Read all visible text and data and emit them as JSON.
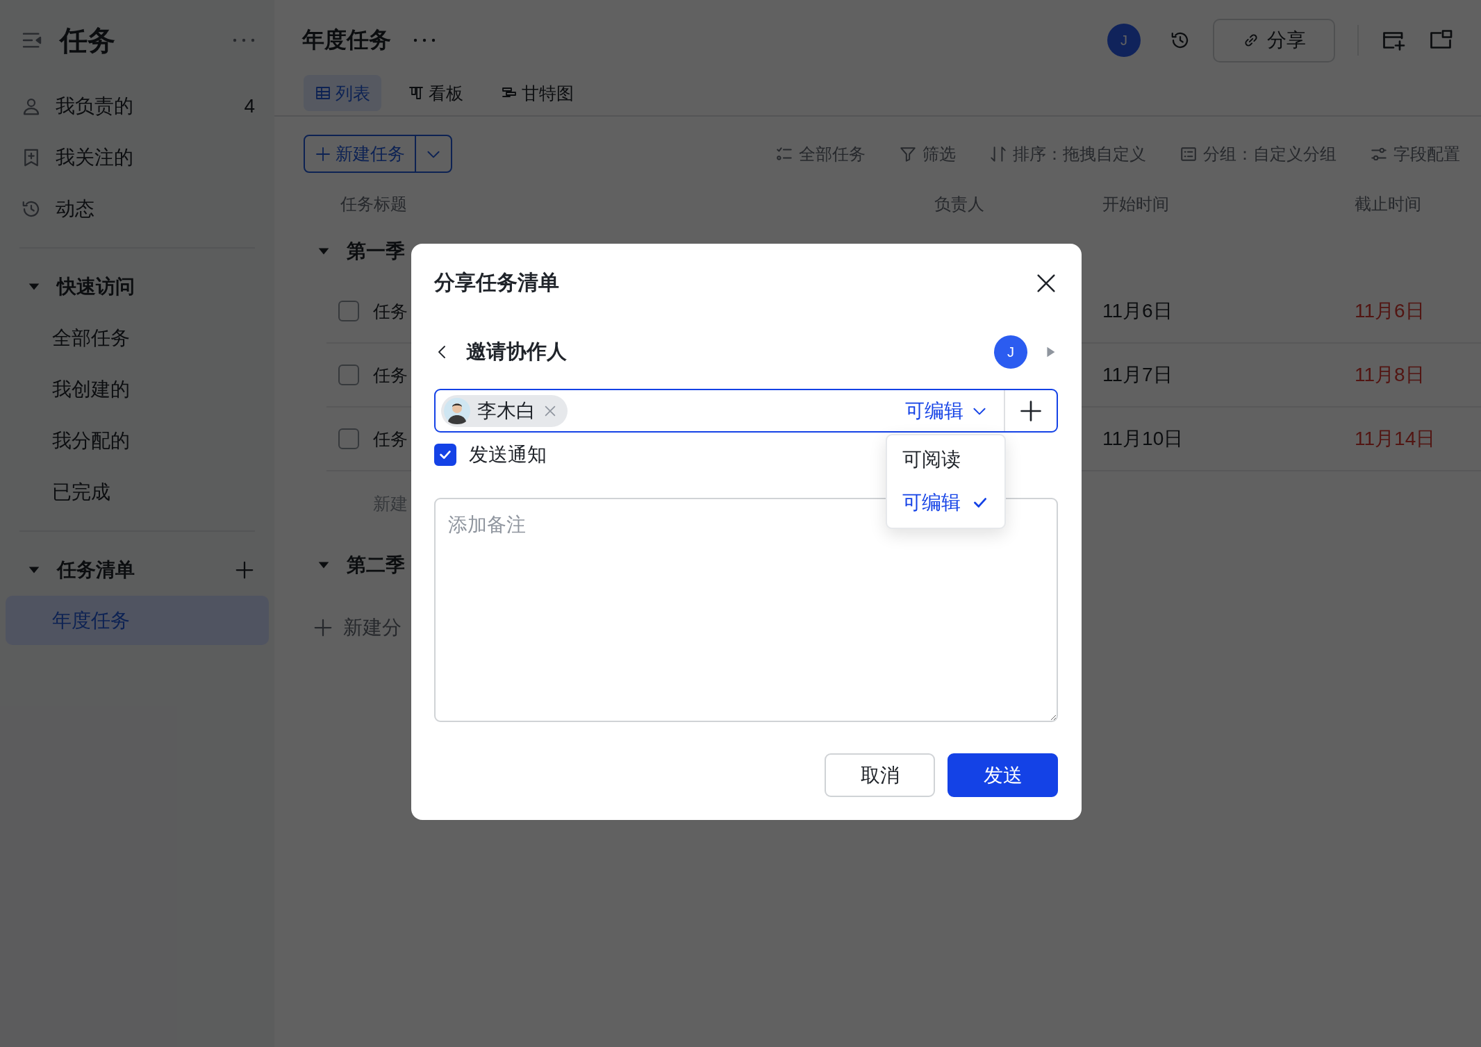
{
  "sidebar": {
    "title": "任务",
    "items": [
      {
        "label": "我负责的",
        "count": "4"
      },
      {
        "label": "我关注的"
      },
      {
        "label": "动态"
      }
    ],
    "sections": [
      {
        "title": "快速访问",
        "expanded": true,
        "addable": false,
        "items": [
          {
            "label": "全部任务",
            "selected": false
          },
          {
            "label": "我创建的",
            "selected": false
          },
          {
            "label": "我分配的",
            "selected": false
          },
          {
            "label": "已完成",
            "selected": false
          }
        ]
      },
      {
        "title": "任务清单",
        "expanded": true,
        "addable": true,
        "items": [
          {
            "label": "年度任务",
            "selected": true
          }
        ]
      }
    ]
  },
  "header": {
    "title": "年度任务",
    "avatar": "J",
    "share_label": "分享"
  },
  "view_tabs": [
    {
      "label": "列表",
      "selected": true
    },
    {
      "label": "看板",
      "selected": false
    },
    {
      "label": "甘特图",
      "selected": false
    }
  ],
  "new_task_button": "新建任务",
  "toolbar": [
    "全部任务",
    "筛选",
    "排序：拖拽自定义",
    "分组：自定义分组",
    "字段配置"
  ],
  "table": {
    "columns": [
      "任务标题",
      "负责人",
      "开始时间",
      "截止时间"
    ],
    "groups": [
      {
        "title": "第一季",
        "expanded": true,
        "rows": [
          {
            "title": "任务",
            "checked": false,
            "start": "11月6日",
            "due": "11月6日",
            "overdue": true
          },
          {
            "title": "任务",
            "checked": false,
            "start": "11月7日",
            "due": "11月8日",
            "overdue": true
          },
          {
            "title": "任务",
            "checked": false,
            "start": "11月10日",
            "due": "11月14日",
            "overdue": true
          }
        ],
        "new_row": "新建"
      },
      {
        "title": "第二季",
        "expanded": true
      }
    ],
    "new_group": "新建分"
  },
  "dialog": {
    "title": "分享任务清单",
    "subtitle": "邀请协作人",
    "avatar": "J",
    "invitees": [
      {
        "name": "李木白"
      }
    ],
    "permission": "可编辑",
    "permission_options": [
      {
        "label": "可阅读",
        "selected": false
      },
      {
        "label": "可编辑",
        "selected": true
      }
    ],
    "notify": {
      "label": "发送通知",
      "checked": true
    },
    "note": {
      "placeholder": "添加备注"
    },
    "buttons": [
      {
        "label": "取消",
        "kind": "secondary"
      },
      {
        "label": "发送",
        "kind": "primary"
      }
    ]
  }
}
